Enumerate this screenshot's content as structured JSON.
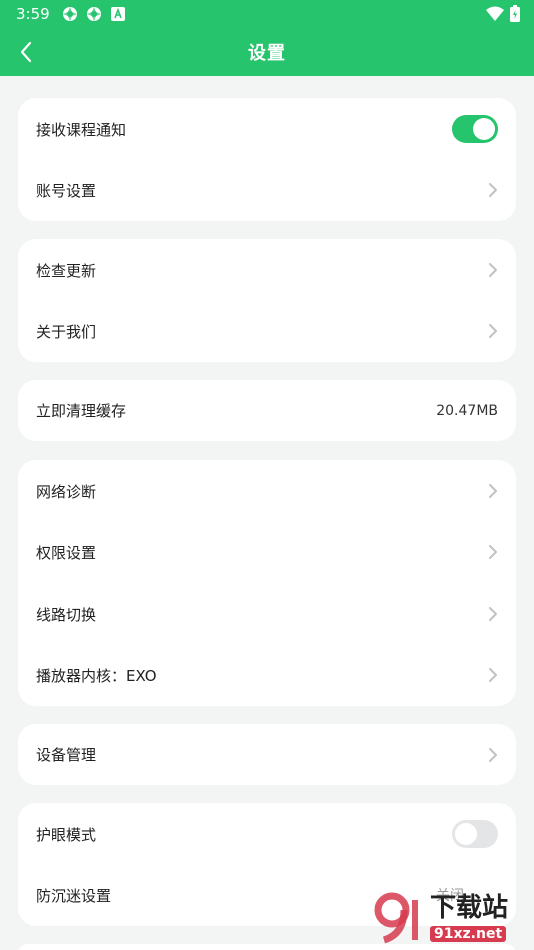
{
  "status_bar": {
    "time": "3:59"
  },
  "app_bar": {
    "title": "设置"
  },
  "groups": [
    {
      "items": [
        {
          "label": "接收课程通知",
          "type": "toggle",
          "on": true
        },
        {
          "label": "账号设置",
          "type": "link"
        }
      ]
    },
    {
      "items": [
        {
          "label": "检查更新",
          "type": "link"
        },
        {
          "label": "关于我们",
          "type": "link"
        }
      ]
    },
    {
      "items": [
        {
          "label": "立即清理缓存",
          "type": "value",
          "value": "20.47MB"
        }
      ]
    },
    {
      "items": [
        {
          "label": "网络诊断",
          "type": "link"
        },
        {
          "label": "权限设置",
          "type": "link"
        },
        {
          "label": "线路切换",
          "type": "link"
        },
        {
          "label": "播放器内核：EXO",
          "type": "link"
        }
      ]
    },
    {
      "items": [
        {
          "label": "设备管理",
          "type": "link"
        }
      ]
    },
    {
      "items": [
        {
          "label": "护眼模式",
          "type": "toggle",
          "on": false
        },
        {
          "label": "防沉迷设置",
          "type": "value",
          "value": "关闭"
        }
      ]
    }
  ],
  "watermark": {
    "main": "下载站",
    "sub": "91xz.net"
  },
  "colors": {
    "accent": "#27c46e",
    "background": "#f2f5f4"
  }
}
